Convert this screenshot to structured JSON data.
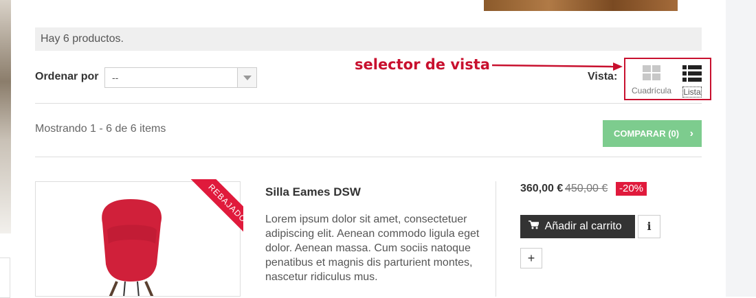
{
  "listing": {
    "product_count": "Hay 6 productos.",
    "sort_label": "Ordenar por",
    "sort_value": "--",
    "annotation": "selector de vista",
    "view_label": "Vista:",
    "view_grid_label": "Cuadrícula",
    "view_list_label": "Lista",
    "showing": "Mostrando 1 - 6 de 6 items",
    "compare_label": "COMPARAR (0)"
  },
  "product": {
    "ribbon": "REBAJADO",
    "title": "Silla Eames DSW",
    "description": "Lorem ipsum dolor sit amet, consectetuer adipiscing elit. Aenean commodo ligula eget dolor. Aenean massa. Cum sociis natoque penatibus et magnis dis parturient montes, nascetur ridiculus mus.",
    "price": "360,00 €",
    "old_price": "450,00 €",
    "discount": "-20%",
    "add_to_cart": "Añadir al carrito",
    "info_icon": "i",
    "plus_icon": "+"
  },
  "colors": {
    "accent_red": "#c8102e",
    "compare_green": "#7dcc8e",
    "sale_red": "#e01a3c",
    "chair_red": "#d0203a"
  },
  "icons": {
    "grid": "grid-view-icon",
    "list": "list-view-icon",
    "cart": "cart-icon",
    "chevron": "chevron-right-icon"
  }
}
